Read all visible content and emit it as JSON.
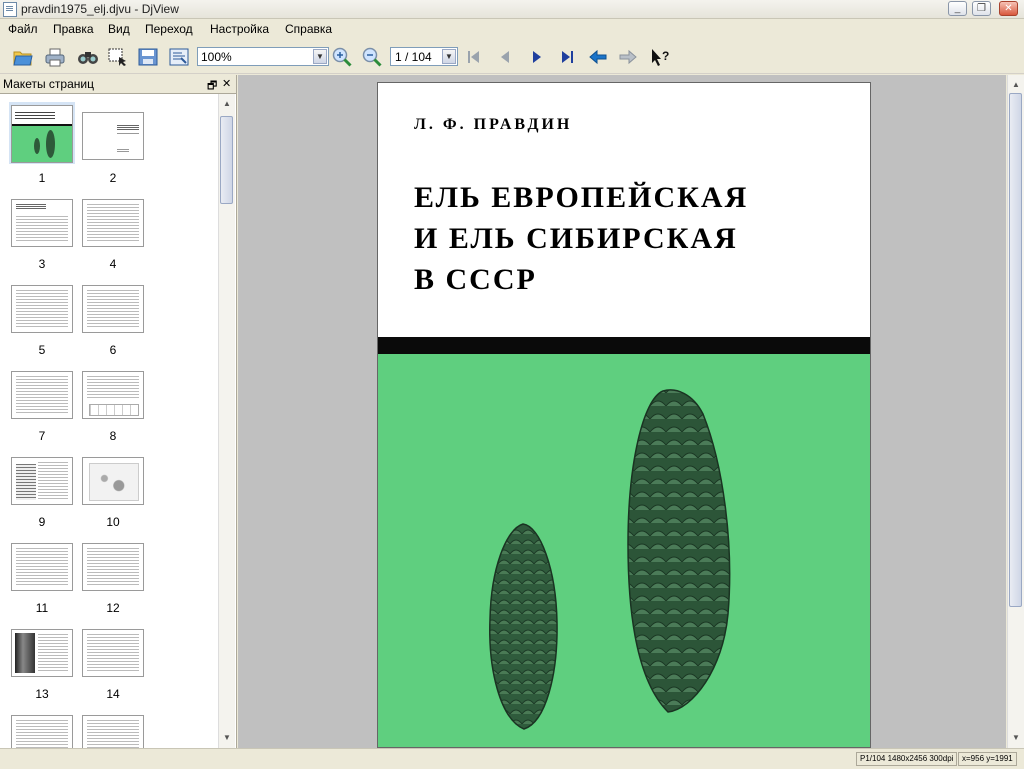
{
  "window": {
    "title": "pravdin1975_elj.djvu - DjView",
    "btn_min": "_",
    "btn_max": "❐",
    "btn_close": "✕"
  },
  "menu": [
    "Файл",
    "Правка",
    "Вид",
    "Переход",
    "Настройка",
    "Справка"
  ],
  "toolbar": {
    "zoom_value": "100%",
    "page_value": "1 / 104",
    "icons": [
      "open-icon",
      "print-icon",
      "find-icon",
      "select-icon",
      "save-icon",
      "export-icon",
      "zoom-in-icon",
      "zoom-out-icon",
      "first-page-icon",
      "prev-page-icon",
      "next-page-icon",
      "last-page-icon",
      "back-icon",
      "forward-icon",
      "whats-this-icon"
    ]
  },
  "sidebar": {
    "title": "Макеты страниц",
    "undock": "🗗",
    "close": "✕",
    "pages": [
      "1",
      "2",
      "3",
      "4",
      "5",
      "6",
      "7",
      "8",
      "9",
      "10",
      "11",
      "12",
      "13",
      "14"
    ]
  },
  "document": {
    "author": "Л. Ф. ПРАВДИН",
    "title_lines": [
      "ЕЛЬ ЕВРОПЕЙСКАЯ",
      "И ЕЛЬ СИБИРСКАЯ",
      "В СССР"
    ],
    "cover_color": "#5fcf7f"
  },
  "status": {
    "page_info": "P1/104 1480x2456 300dpi",
    "coords": "x=956 y=1991"
  }
}
